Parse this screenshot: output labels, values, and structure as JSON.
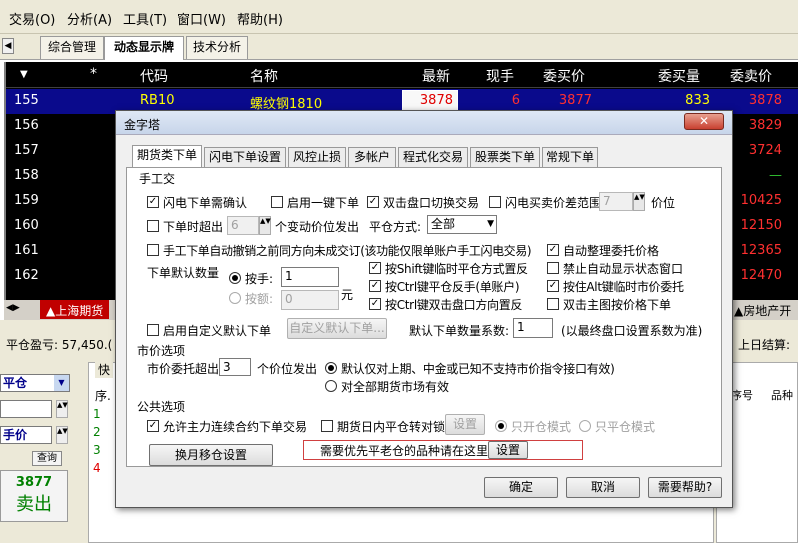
{
  "menu": {
    "items": [
      "交易(O)",
      "分析(A)",
      "工具(T)",
      "窗口(W)",
      "帮助(H)"
    ]
  },
  "tabs": {
    "items": [
      "综合管理",
      "动态显示牌",
      "技术分析"
    ],
    "active": 1
  },
  "quote": {
    "headers": [
      "*",
      "代码",
      "名称",
      "最新",
      "现手",
      "委买价",
      "委买量",
      "委卖价"
    ],
    "rows": [
      {
        "no": "155",
        "code": "RB10",
        "name": "螺纹钢1810",
        "last": "3878",
        "vol": "6",
        "bid": "3877",
        "bidvol": "833",
        "ask": "3878"
      },
      {
        "no": "156",
        "ask": "3829"
      },
      {
        "no": "157",
        "ask": "3724"
      },
      {
        "no": "158",
        "ask": "—"
      },
      {
        "no": "159",
        "ask": "10425"
      },
      {
        "no": "160",
        "ask": "12150"
      },
      {
        "no": "161",
        "ask": "12365"
      },
      {
        "no": "162",
        "ask": "12470"
      }
    ],
    "market_left": "▲上海期货",
    "market_right": "▲房地产开"
  },
  "lower": {
    "pnl": "平仓盈亏: 57,450.(",
    "settle": "上日结算:",
    "open_close": "平仓",
    "price_type": "手价",
    "read": "查询",
    "price": "3877",
    "sell": "卖出",
    "fast": "快",
    "seq": "序.",
    "rows": [
      "1",
      "2",
      "3",
      "4"
    ],
    "col_a": "序号",
    "col_b": "品种"
  },
  "dialog": {
    "title": "金字塔",
    "tabs": [
      "期货类下单",
      "闪电下单设置",
      "风控止损",
      "多帐户",
      "程式化交易",
      "股票类下单",
      "常规下单"
    ],
    "group_manual": "手工交",
    "opt_flash_confirm": "闪电下单需确认",
    "opt_one_key": "启用一键下单",
    "opt_dblclick_switch": "双击盘口切换交易",
    "opt_flash_spread": "闪电买卖价差范围",
    "flash_spread_value": "7",
    "flash_spread_unit": "价位",
    "opt_order_exceed": "下单时超出",
    "order_exceed_value": "6",
    "order_exceed_text": "个变动价位发出",
    "close_mode_label": "平仓方式:",
    "close_mode_value": "全部",
    "opt_manual_cancel": "手工下单自动撤销之前同方向未成交订(该功能仅限单账户手工闪电交易)",
    "opt_auto_arrange": "自动整理委托价格",
    "default_qty_label": "下单默认数量",
    "radio_hand": "按手:",
    "hand_value": "1",
    "radio_amount": "按额:",
    "amount_value": "0",
    "amount_unit": "元",
    "opt_shift": "按Shift键临时平仓方式置反",
    "opt_ctrl_reverse": "按Ctrl键平仓反手(单账户)",
    "opt_ctrl_dbl": "按Ctrl键双击盘口方向置反",
    "opt_no_status": "禁止自动显示状态窗口",
    "opt_alt": "按住Alt键临时市价委托",
    "opt_dbl_main": "双击主图按价格下单",
    "opt_custom_qty": "启用自定义默认下单",
    "btn_custom_qty": "自定义默认下单...",
    "default_coef_label": "默认下单数量系数:",
    "default_coef_value": "1",
    "default_coef_note": "(以最终盘口设置系数为准)",
    "group_market": "市价选项",
    "market_exceed_label": "市价委托超出",
    "market_exceed_value": "3",
    "market_exceed_text": "个价位发出",
    "market_radio_1": "默认仅对上期、中金或已知不支持市价指令接口有效)",
    "market_radio_2": "对全部期货市场有效",
    "group_common": "公共选项",
    "opt_main_contract": "允许主力连续合约下单交易",
    "opt_intraday_close": "期货日内平仓转对锁",
    "btn_intraday_set": "设置",
    "radio_open_only": "只开仓模式",
    "radio_close_only": "只平仓模式",
    "btn_month_shift": "换月移仓设置",
    "priority_text": "需要优先平老仓的品种请在这里",
    "btn_priority_set": "设置",
    "btn_ok": "确定",
    "btn_cancel": "取消",
    "btn_help": "需要帮助?"
  }
}
